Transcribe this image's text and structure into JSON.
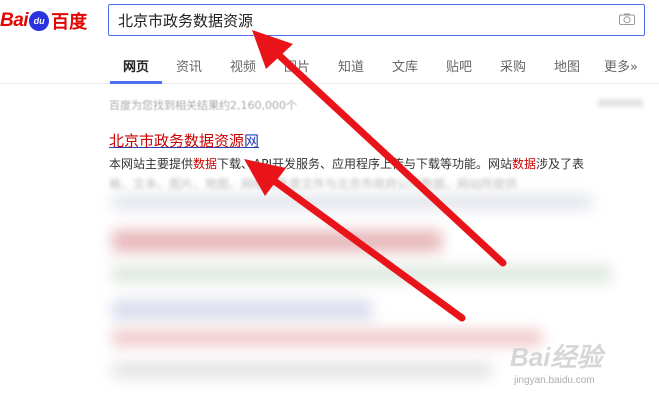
{
  "logo": {
    "bai": "Bai",
    "paw": "du",
    "cn": "百度"
  },
  "search": {
    "value": "北京市政务数据资源",
    "camera_icon": "camera-icon"
  },
  "tabs": [
    {
      "label": "网页",
      "active": true
    },
    {
      "label": "资讯"
    },
    {
      "label": "视频"
    },
    {
      "label": "图片"
    },
    {
      "label": "知道"
    },
    {
      "label": "文库"
    },
    {
      "label": "贴吧"
    },
    {
      "label": "采购"
    },
    {
      "label": "地图"
    },
    {
      "label": "更多»"
    }
  ],
  "results": {
    "count": "百度为您找到相关结果约2,160,000个",
    "title_kw": "北京市政务数据资源",
    "title_rest": "网",
    "snippet_1": "本网站主要提供",
    "snippet_kw1": "数据",
    "snippet_2": "下载、API开发服务、应用程序上传与下载等功能。网站",
    "snippet_kw2": "数据",
    "snippet_3": "涉及了表",
    "snippet_line2": "格、文本、图片、地图、网络等各类文件与北京市政府公开数据，网站所提供"
  },
  "watermark": {
    "main": "Bai经验",
    "sub": "jingyan.baidu.com"
  },
  "colors": {
    "brand_red": "#e10602",
    "brand_blue": "#2932e1",
    "link": "#2440b3",
    "highlight": "#c00000",
    "arrow": "#e8141a"
  }
}
